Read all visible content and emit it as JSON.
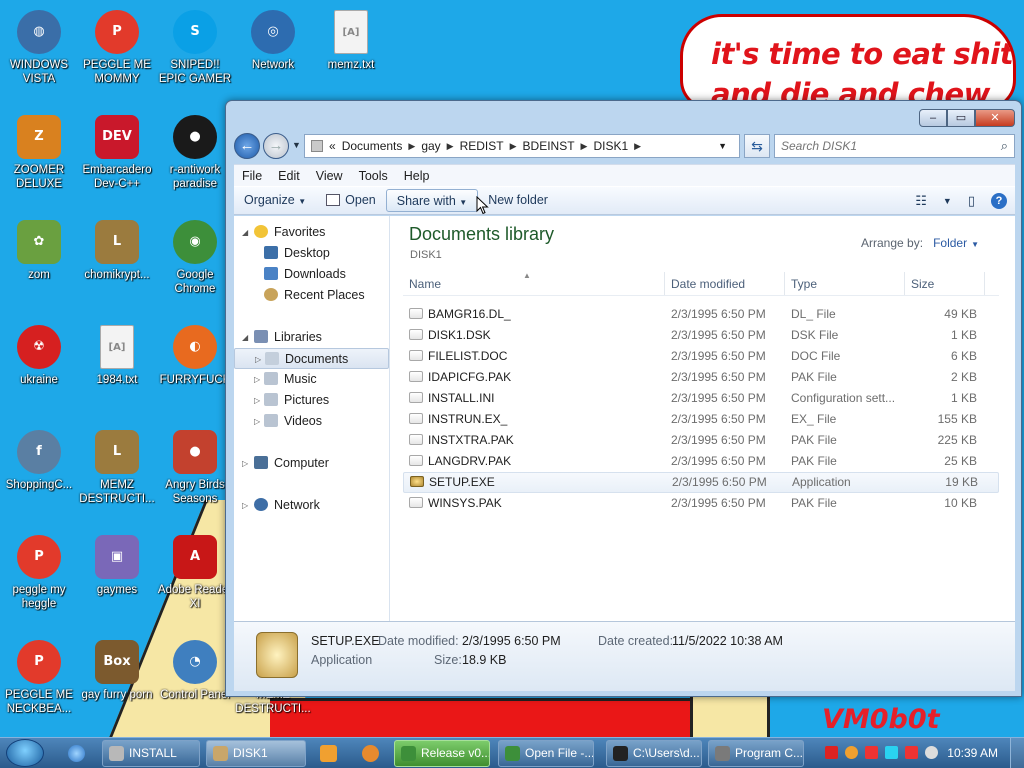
{
  "desktop": {
    "bubble_line1": "it's time to eat shit",
    "bubble_line2": "and die and chew",
    "signature": "VM0b0t",
    "icons": [
      {
        "label": "WINDOWS VISTA",
        "icon": "vista-icon",
        "color": "#3a6ea8"
      },
      {
        "label": "PEGGLE ME MOMMY",
        "icon": "peggle-icon",
        "color": "#e23a2b"
      },
      {
        "label": "SNIPED!! EPIC GAMER 360...",
        "icon": "skype-icon",
        "color": "#0aa0e6"
      },
      {
        "label": "Network",
        "icon": "network-icon",
        "color": "#2d6cb0"
      },
      {
        "label": "memz.txt",
        "icon": "text-file-icon",
        "color": "#f1f1f1"
      },
      {
        "label": "ZOOMER DELUXE",
        "icon": "zoomer-icon",
        "color": "#d9811f"
      },
      {
        "label": "Embarcadero Dev-C++",
        "icon": "devcpp-icon",
        "color": "#c9182b"
      },
      {
        "label": "r-antiwork paradise",
        "icon": "reddit-icon",
        "color": "#1a1a1a"
      },
      {
        "label": "zom",
        "icon": "flower-icon",
        "color": "#6aa040"
      },
      {
        "label": "chomikrypt...",
        "icon": "hourglass-icon",
        "color": "#9b7b3e"
      },
      {
        "label": "Google Chrome",
        "icon": "chrome-icon",
        "color": "#3d8f3a"
      },
      {
        "label": "ukraine",
        "icon": "radiation-icon",
        "color": "#d62020"
      },
      {
        "label": "1984.txt",
        "icon": "text-file-icon",
        "color": "#f1f1f1"
      },
      {
        "label": "FURRYFUCK",
        "icon": "firefox-icon",
        "color": "#e86a1f"
      },
      {
        "label": "ShoppingC...",
        "icon": "flash-icon",
        "color": "#5a7fa3"
      },
      {
        "label": "MEMZ DESTRUCTI...",
        "icon": "hourglass-icon",
        "color": "#9b7b3e"
      },
      {
        "label": "Angry Birds Seasons",
        "icon": "angry-birds-icon",
        "color": "#c3412e"
      },
      {
        "label": "peggle my heggle",
        "icon": "peggle-icon",
        "color": "#e23a2b"
      },
      {
        "label": "gaymes",
        "icon": "games-icon",
        "color": "#7a68b8"
      },
      {
        "label": "Adobe Reader XI",
        "icon": "adobe-reader-icon",
        "color": "#c81717"
      },
      {
        "label": "PEGGLE ME NECKBEA...",
        "icon": "peggle-icon",
        "color": "#e23a2b"
      },
      {
        "label": "gay furry porn",
        "icon": "boxed-beaver-icon",
        "color": "#7c5a2e"
      },
      {
        "label": "Control Panel",
        "icon": "control-panel-icon",
        "color": "#3f7fbf"
      },
      {
        "label": "MEMZ DESTRUCTI...",
        "icon": "hourglass-icon",
        "color": "#9b7b3e"
      }
    ]
  },
  "window": {
    "caption_min": "–",
    "caption_max": "▭",
    "caption_close": "✕",
    "breadcrumb_prefix": "«",
    "breadcrumb": [
      "Documents",
      "gay",
      "REDIST",
      "BDEINST",
      "DISK1"
    ],
    "search_placeholder": "Search DISK1",
    "menu": [
      "File",
      "Edit",
      "View",
      "Tools",
      "Help"
    ],
    "toolbar": {
      "organize": "Organize",
      "open": "Open",
      "share_with": "Share with",
      "new_folder": "New folder"
    },
    "nav": {
      "favorites": "Favorites",
      "desktop": "Desktop",
      "downloads": "Downloads",
      "recent_places": "Recent Places",
      "libraries": "Libraries",
      "documents": "Documents",
      "music": "Music",
      "pictures": "Pictures",
      "videos": "Videos",
      "computer": "Computer",
      "network": "Network"
    },
    "library_title": "Documents library",
    "library_subtitle": "DISK1",
    "arrange_by_label": "Arrange by:",
    "arrange_by_value": "Folder",
    "columns": {
      "name": "Name",
      "date": "Date modified",
      "type": "Type",
      "size": "Size"
    },
    "files": [
      {
        "name": "BAMGR16.DL_",
        "date": "2/3/1995 6:50 PM",
        "type": "DL_ File",
        "size": "49 KB"
      },
      {
        "name": "DISK1.DSK",
        "date": "2/3/1995 6:50 PM",
        "type": "DSK File",
        "size": "1 KB"
      },
      {
        "name": "FILELIST.DOC",
        "date": "2/3/1995 6:50 PM",
        "type": "DOC File",
        "size": "6 KB"
      },
      {
        "name": "IDAPICFG.PAK",
        "date": "2/3/1995 6:50 PM",
        "type": "PAK File",
        "size": "2 KB"
      },
      {
        "name": "INSTALL.INI",
        "date": "2/3/1995 6:50 PM",
        "type": "Configuration sett...",
        "size": "1 KB"
      },
      {
        "name": "INSTRUN.EX_",
        "date": "2/3/1995 6:50 PM",
        "type": "EX_ File",
        "size": "155 KB"
      },
      {
        "name": "INSTXTRA.PAK",
        "date": "2/3/1995 6:50 PM",
        "type": "PAK File",
        "size": "225 KB"
      },
      {
        "name": "LANGDRV.PAK",
        "date": "2/3/1995 6:50 PM",
        "type": "PAK File",
        "size": "25 KB"
      },
      {
        "name": "SETUP.EXE",
        "date": "2/3/1995 6:50 PM",
        "type": "Application",
        "size": "19 KB"
      },
      {
        "name": "WINSYS.PAK",
        "date": "2/3/1995 6:50 PM",
        "type": "PAK File",
        "size": "10 KB"
      }
    ],
    "details": {
      "name": "SETUP.EXE",
      "type": "Application",
      "modified_label": "Date modified:",
      "modified_value": "2/3/1995 6:50 PM",
      "size_label": "Size:",
      "size_value": "18.9 KB",
      "created_label": "Date created:",
      "created_value": "11/5/2022 10:38 AM"
    }
  },
  "taskbar": {
    "buttons": [
      {
        "label": "INSTALL",
        "icon": "install-icon"
      },
      {
        "label": "DISK1",
        "icon": "folder-icon"
      },
      {
        "label": "Release v0....",
        "icon": "chrome-icon"
      },
      {
        "label": "Open File -...",
        "icon": "chrome-icon"
      },
      {
        "label": "C:\\Users\\d...",
        "icon": "7zip-icon"
      },
      {
        "label": "Program C...",
        "icon": "program-icon"
      }
    ],
    "clock": "10:39 AM"
  }
}
